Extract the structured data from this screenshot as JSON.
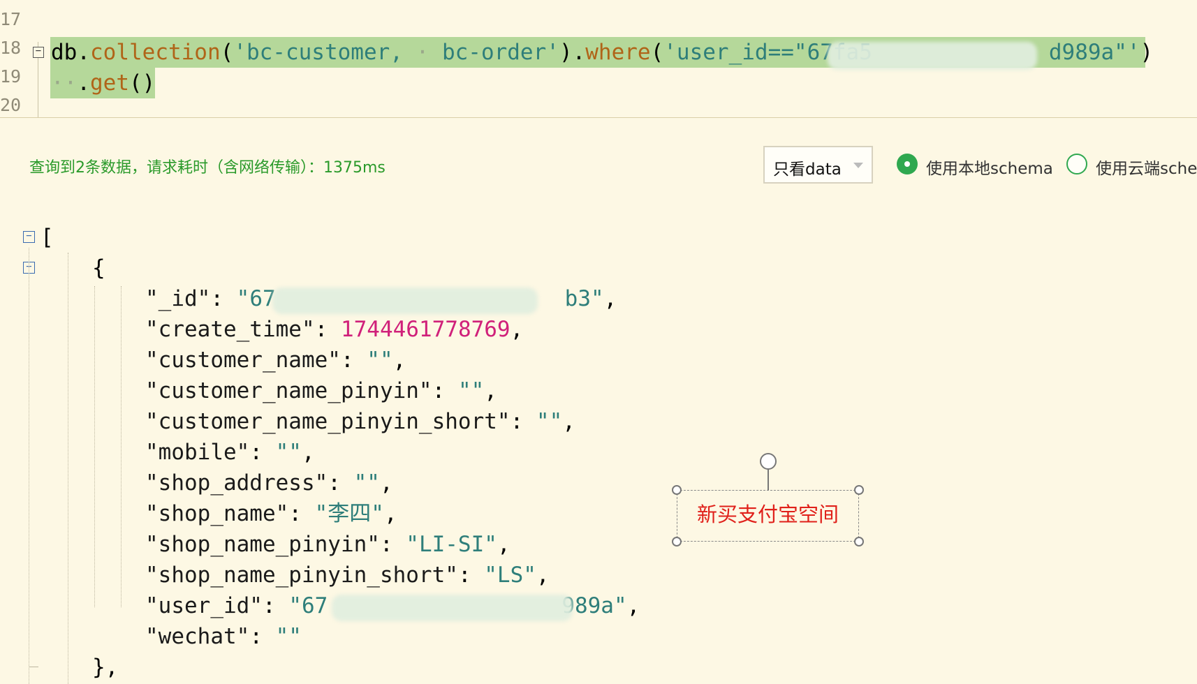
{
  "editor": {
    "line_numbers": [
      "17",
      "18",
      "19",
      "20"
    ],
    "line18": {
      "db": "db.",
      "collection": "collection",
      "open": "(",
      "collection_arg": "'bc-customer,",
      "space_mark": " · ",
      "collection_arg2": "bc-order'",
      "close_dot": ").",
      "where": "where",
      "open2": "(",
      "where_arg": "'user_id==\"67fa5",
      "where_arg_end": "d989a\"'",
      "close2": ")"
    },
    "line19": {
      "indent": "··",
      "dot": ".",
      "get": "get",
      "parens": "()"
    }
  },
  "toolbar": {
    "status_text": "查询到2条数据，请求耗时（含网络传输）：1375ms",
    "view_select": {
      "selected": "只看data"
    },
    "radio_local": {
      "label": "使用本地schema",
      "checked": true
    },
    "radio_cloud": {
      "label": "使用云端sche",
      "checked": false
    }
  },
  "result": {
    "open_array": "[",
    "open_object": "{",
    "close_object": "},",
    "fields": [
      {
        "key": "\"_id\"",
        "value": "\"67",
        "value_end": "b3\"",
        "kind": "string"
      },
      {
        "key": "\"create_time\"",
        "value": "1744461778769",
        "kind": "number"
      },
      {
        "key": "\"customer_name\"",
        "value": "\"\"",
        "kind": "string"
      },
      {
        "key": "\"customer_name_pinyin\"",
        "value": "\"\"",
        "kind": "string"
      },
      {
        "key": "\"customer_name_pinyin_short\"",
        "value": "\"\"",
        "kind": "string"
      },
      {
        "key": "\"mobile\"",
        "value": "\"\"",
        "kind": "string"
      },
      {
        "key": "\"shop_address\"",
        "value": "\"\"",
        "kind": "string"
      },
      {
        "key": "\"shop_name\"",
        "value": "\"李四\"",
        "kind": "string"
      },
      {
        "key": "\"shop_name_pinyin\"",
        "value": "\"LI-SI\"",
        "kind": "string"
      },
      {
        "key": "\"shop_name_pinyin_short\"",
        "value": "\"LS\"",
        "kind": "string"
      },
      {
        "key": "\"user_id\"",
        "value": "\"67",
        "value_end": "989a\"",
        "kind": "string"
      },
      {
        "key": "\"wechat\"",
        "value": "\"\"",
        "kind": "string",
        "last": true
      }
    ]
  },
  "annotation": {
    "text": "新买支付宝空间"
  },
  "colors": {
    "background": "#fdf8e4",
    "highlight": "#b5d89a",
    "string": "#2e7e7a",
    "number": "#d0207a",
    "function": "#b06418",
    "status_green": "#2a9a2a",
    "radio_green": "#2fa84f",
    "annotation_red": "#e0201a"
  }
}
